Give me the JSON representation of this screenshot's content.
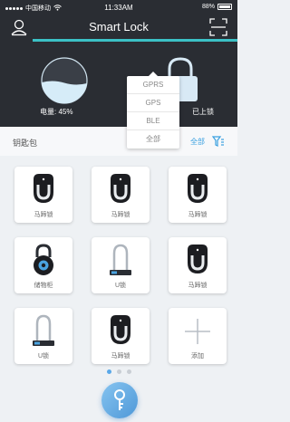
{
  "status_bar": {
    "carrier": "中国移动",
    "time": "11:33AM",
    "battery": "88%"
  },
  "header": {
    "title": "Smart Lock",
    "icons": {
      "left": "user-icon",
      "right": "scan-icon"
    },
    "accent_color": "#3bc1c6"
  },
  "battery_card": {
    "label": "电量: 45%",
    "level": 0.45
  },
  "lock_card": {
    "label": "已上锁"
  },
  "dropdown": {
    "options": [
      "GPRS",
      "GPS",
      "BLE",
      "全部"
    ]
  },
  "keychain": {
    "title": "钥匙包",
    "filter_label": "全部",
    "items": [
      {
        "label": "马蹄锁",
        "icon": "horseshoe-lock-icon"
      },
      {
        "label": "马蹄锁",
        "icon": "horseshoe-lock-icon"
      },
      {
        "label": "马蹄锁",
        "icon": "horseshoe-lock-icon"
      },
      {
        "label": "储物柜",
        "icon": "cabinet-lock-icon"
      },
      {
        "label": "U锁",
        "icon": "u-lock-icon"
      },
      {
        "label": "马蹄锁",
        "icon": "horseshoe-lock-icon"
      },
      {
        "label": "U锁",
        "icon": "u-lock-icon"
      },
      {
        "label": "马蹄锁",
        "icon": "horseshoe-lock-icon"
      },
      {
        "label": "添加",
        "icon": "add-icon"
      }
    ]
  },
  "pager": {
    "count": 3,
    "active": 0
  },
  "key_button": {
    "icon": "key-icon"
  }
}
